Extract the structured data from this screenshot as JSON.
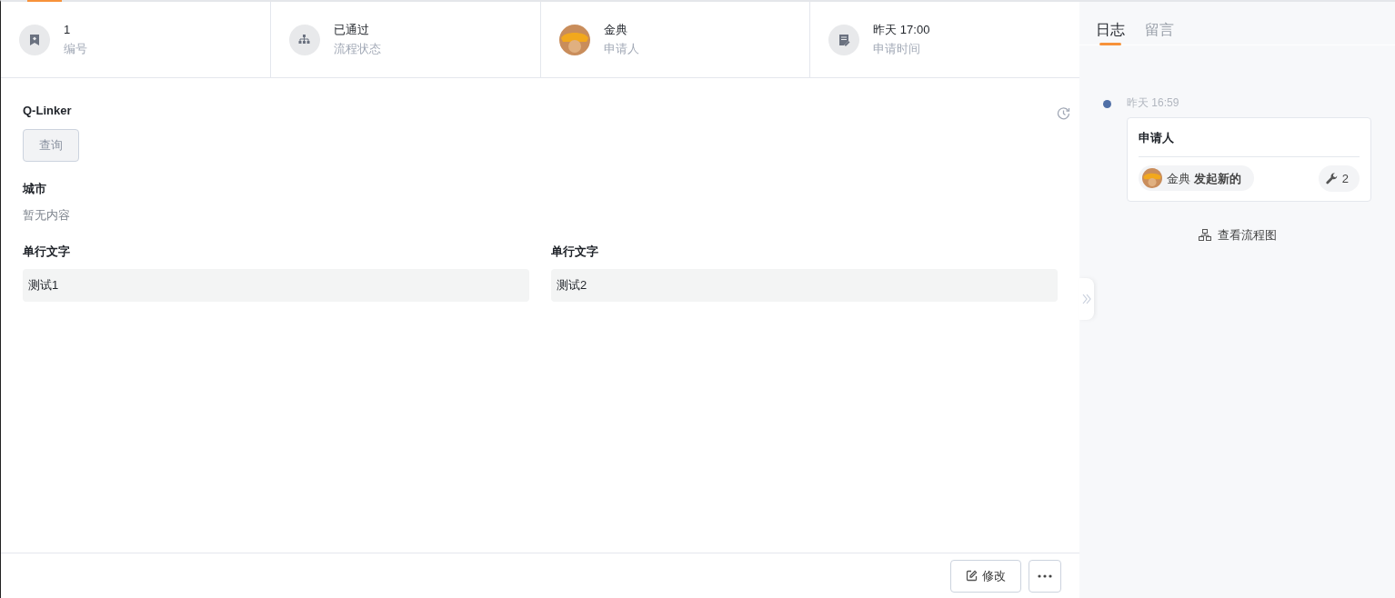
{
  "summary": [
    {
      "kind": "icon",
      "value": "1",
      "label": "编号"
    },
    {
      "kind": "icon",
      "value": "已通过",
      "label": "流程状态"
    },
    {
      "kind": "avatar",
      "value": "金典",
      "label": "申请人"
    },
    {
      "kind": "icon",
      "value": "昨天 17:00",
      "label": "申请时间"
    }
  ],
  "form": {
    "rows": [
      [
        {
          "kind": "button",
          "label": "Q-Linker",
          "button": "查询",
          "disabled": true
        }
      ],
      [
        {
          "kind": "empty",
          "label": "城市",
          "text": "暂无内容"
        }
      ],
      [
        {
          "kind": "value",
          "label": "单行文字",
          "value": "测试1"
        },
        {
          "kind": "value",
          "label": "单行文字",
          "value": "测试2"
        }
      ]
    ]
  },
  "actions": {
    "edit": "修改"
  },
  "side": {
    "tabs": [
      {
        "label": "日志",
        "selected": true
      },
      {
        "label": "留言",
        "selected": false
      }
    ],
    "log": [
      {
        "time": "昨天 16:59",
        "title": "申请人",
        "who": "金典 **发起新的**",
        "count": "2"
      }
    ],
    "flow_link": "查看流程图"
  }
}
